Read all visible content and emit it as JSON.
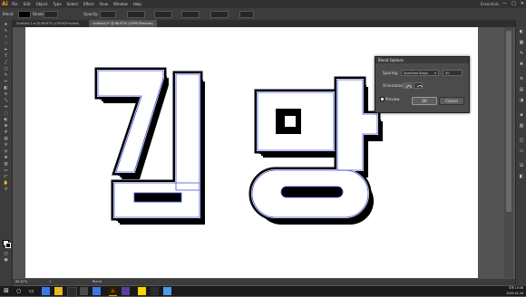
{
  "app": {
    "logo": "Ai",
    "workspace": "Essentials"
  },
  "menus": [
    "File",
    "Edit",
    "Object",
    "Type",
    "Select",
    "Effect",
    "View",
    "Window",
    "Help"
  ],
  "window_buttons": [
    "—",
    "□",
    "✕"
  ],
  "control": {
    "object_type": "Blend",
    "stroke_label": "Stroke:",
    "opacity_label": "Opacity:"
  },
  "tabs": [
    {
      "label": "Untitled-1.ai @ 66.67% (CMYK/Preview)",
      "active": false
    },
    {
      "label": "Untitled-2* @ 66.67% (CMYK/Preview)",
      "active": true
    }
  ],
  "status": {
    "zoom": "66.67%",
    "page": "1",
    "tool": "Blend"
  },
  "artwork": {
    "text": "김망",
    "fill": "#ffffff",
    "stroke": "#000000",
    "guide": "#3b4fd8"
  },
  "dialog": {
    "title": "Blend Options",
    "spacing_label": "Spacing:",
    "spacing_value": "Specified Steps",
    "steps_value": "50",
    "orientation_label": "Orientation:",
    "preview_label": "Preview",
    "preview_checked": true,
    "ok_label": "OK",
    "cancel_label": "Cancel"
  },
  "taskbar": {
    "time": "오후 10:46",
    "date": "2019-01-26"
  }
}
